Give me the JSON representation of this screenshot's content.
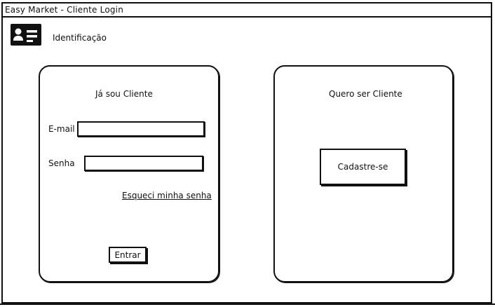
{
  "window": {
    "title": "Easy Market - Cliente Login"
  },
  "header": {
    "icon": "id-card-icon",
    "label": "Identificação"
  },
  "login_panel": {
    "title": "Já sou Cliente",
    "email_label": "E-mail",
    "email_value": "",
    "password_label": "Senha",
    "password_value": "",
    "forgot_link": "Esqueci minha senha",
    "submit_label": "Entrar"
  },
  "signup_panel": {
    "title": "Quero ser Cliente",
    "signup_button": "Cadastre-se"
  }
}
